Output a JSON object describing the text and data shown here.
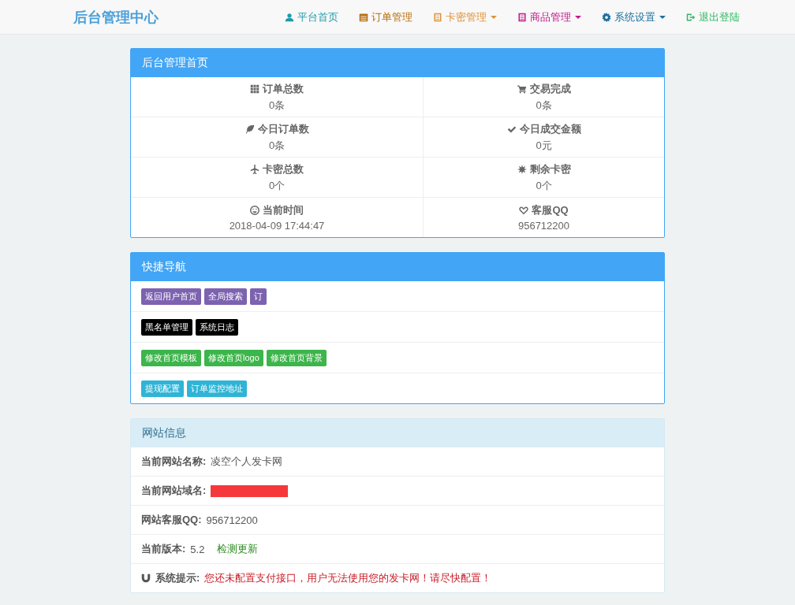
{
  "navbar": {
    "brand": "后台管理中心",
    "items": [
      {
        "label": "平台首页",
        "color": "#1e9aa8",
        "dropdown": false
      },
      {
        "label": "订单管理",
        "color": "#b86d10",
        "dropdown": false
      },
      {
        "label": "卡密管理",
        "color": "#e0923a",
        "dropdown": true
      },
      {
        "label": "商品管理",
        "color": "#c2168c",
        "dropdown": true
      },
      {
        "label": "系统设置",
        "color": "#1b6f9e",
        "dropdown": true
      },
      {
        "label": "退出登陆",
        "color": "#2fb864",
        "dropdown": false
      }
    ]
  },
  "overview": {
    "title": "后台管理首页",
    "stats": [
      {
        "label": "订单总数",
        "value": "0条"
      },
      {
        "label": "交易完成",
        "value": "0条"
      },
      {
        "label": "今日订单数",
        "value": "0条"
      },
      {
        "label": "今日成交金额",
        "value": "0元"
      },
      {
        "label": "卡密总数",
        "value": "0个"
      },
      {
        "label": "剩余卡密",
        "value": "0个"
      },
      {
        "label": "当前时间",
        "value": "2018-04-09 17:44:47"
      },
      {
        "label": "客服QQ",
        "value": "956712200"
      }
    ]
  },
  "quick_nav": {
    "title": "快捷导航",
    "rows": [
      [
        {
          "label": "返回用户首页",
          "color": "#7d62b0"
        },
        {
          "label": "全局搜索",
          "color": "#7d62b0"
        },
        {
          "label": "订",
          "color": "#7d62b0"
        }
      ],
      [
        {
          "label": "黑名单管理",
          "color": "#000000"
        },
        {
          "label": "系统日志",
          "color": "#000000"
        }
      ],
      [
        {
          "label": "修改首页模板",
          "color": "#3cb54a"
        },
        {
          "label": "修改首页logo",
          "color": "#3cb54a"
        },
        {
          "label": "修改首页背景",
          "color": "#3cb54a"
        }
      ],
      [
        {
          "label": "提现配置",
          "color": "#2fb4d6"
        },
        {
          "label": "订单监控地址",
          "color": "#2fb4d6"
        }
      ]
    ]
  },
  "site_info": {
    "title": "网站信息",
    "rows": [
      {
        "kind": "text",
        "label": "当前网站名称:",
        "value": "凌空个人发卡网"
      },
      {
        "kind": "redacted",
        "label": "当前网站域名:"
      },
      {
        "kind": "text",
        "label": "网站客服QQ:",
        "value": "956712200"
      },
      {
        "kind": "link",
        "label": "当前版本:",
        "value": "5.2",
        "link": "检测更新"
      },
      {
        "kind": "alert",
        "label": "系统提示:",
        "value": "您还未配置支付接口，用户无法使用您的发卡网！请尽快配置！"
      }
    ]
  }
}
